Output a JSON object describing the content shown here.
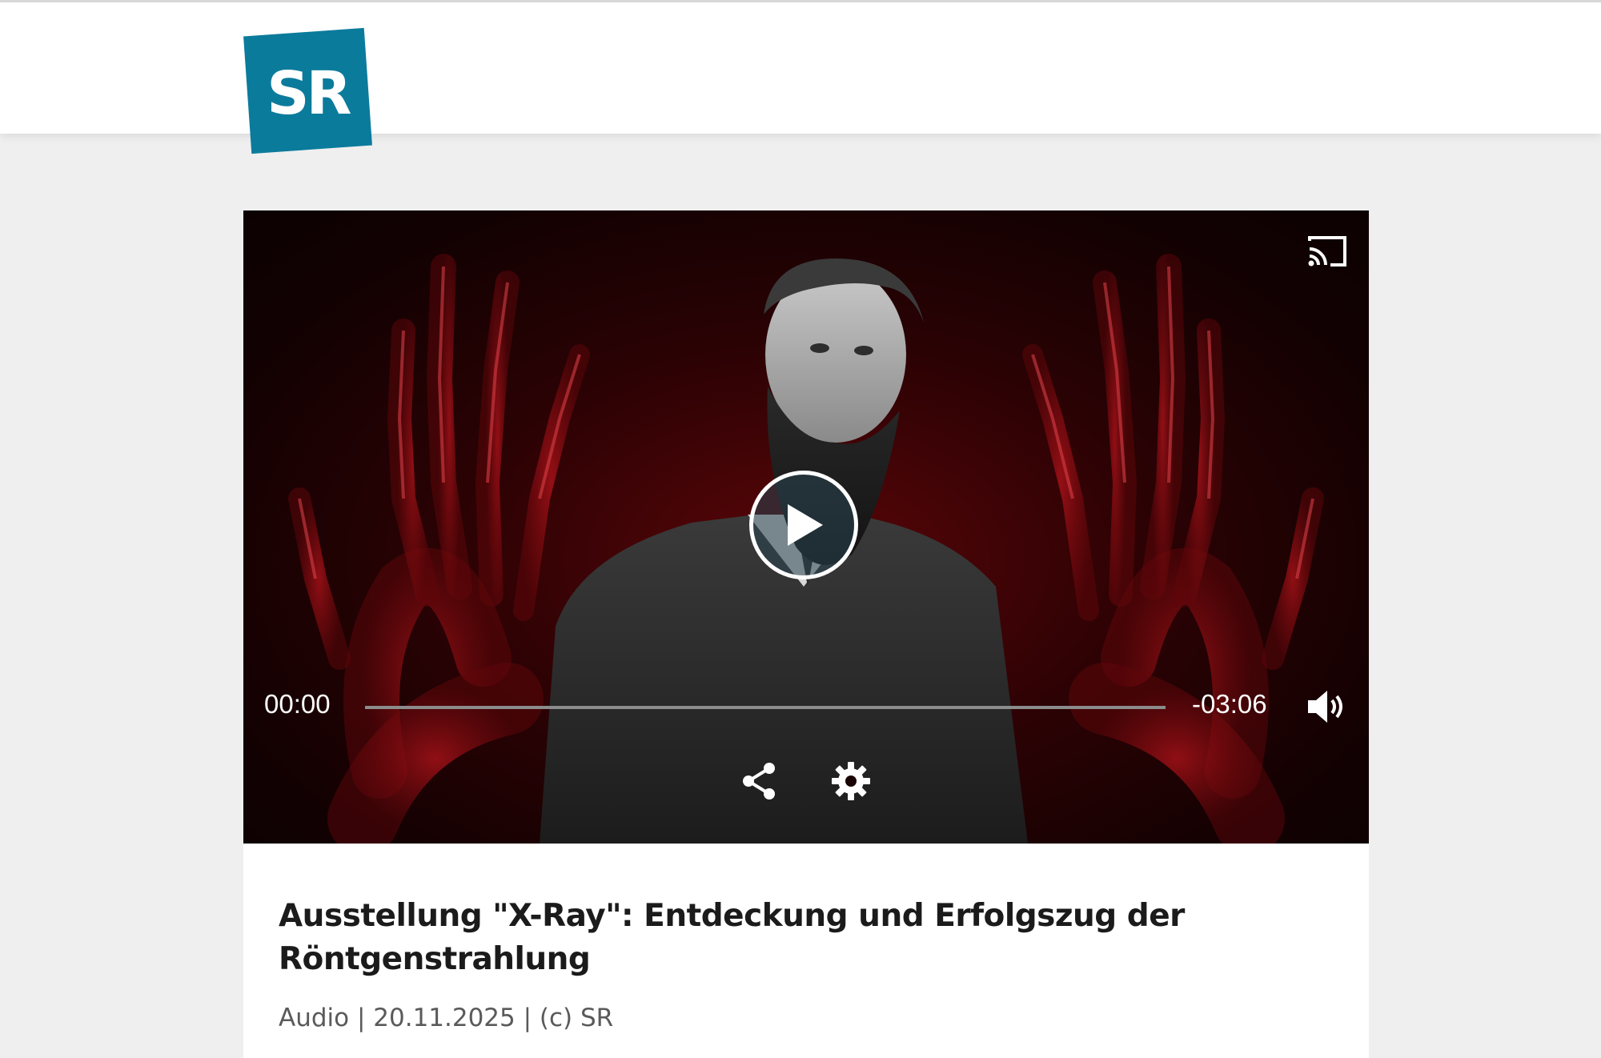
{
  "header": {
    "logo_text": "SR",
    "brand_color": "#0b7b9c"
  },
  "player": {
    "poster_description_icons": [
      "x-ray-hand",
      "portrait"
    ],
    "current_time": "00:00",
    "remaining_time": "-03:06",
    "progress": 0.0,
    "controls": {
      "cast_icon": "cast-icon",
      "play_icon": "play-icon",
      "volume_icon": "volume-icon",
      "share_icon": "share-icon",
      "settings_icon": "gear-icon"
    }
  },
  "article": {
    "title": "Ausstellung \"X-Ray\": Entdeckung und Erfolgszug der Röntgenstrahlung",
    "meta": "Audio | 20.11.2025 | (c) SR"
  },
  "colors": {
    "page_background": "#efefef",
    "card_background": "#ffffff",
    "title_color": "#1b1b1b",
    "meta_color": "#5a5a5a"
  }
}
